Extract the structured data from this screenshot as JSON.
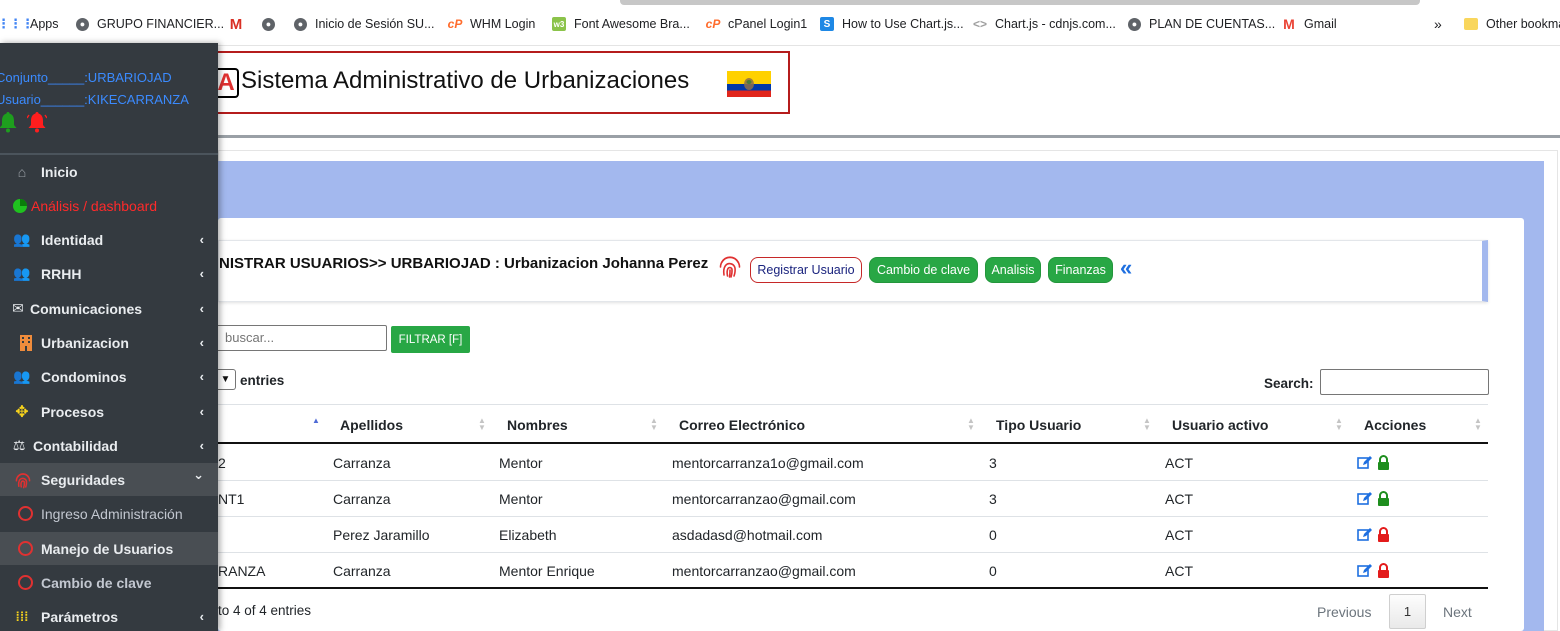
{
  "bookmarks": {
    "items": [
      {
        "label": "Apps",
        "icon": "apps-grid-icon"
      },
      {
        "label": "GRUPO FINANCIER...",
        "icon": "globe-icon"
      },
      {
        "label": "",
        "icon": "gmail-m-icon"
      },
      {
        "label": "",
        "icon": "globe-icon"
      },
      {
        "label": "Inicio de Sesión SU...",
        "icon": "globe-icon"
      },
      {
        "label": "WHM Login",
        "icon": "cpanel-icon"
      },
      {
        "label": "Font Awesome Bra...",
        "icon": "w3-icon"
      },
      {
        "label": "cPanel Login1",
        "icon": "cpanel-icon"
      },
      {
        "label": "How to Use Chart.js...",
        "icon": "s-icon"
      },
      {
        "label": "Chart.js - cdnjs.com...",
        "icon": "code-icon"
      },
      {
        "label": "PLAN DE CUENTAS...",
        "icon": "globe-icon"
      },
      {
        "label": "Gmail",
        "icon": "gmail-icon"
      }
    ],
    "overflow": "»",
    "other_label": "Other bookma"
  },
  "sidebar": {
    "conjunto": "Conjunto_____:URBARIOJAD",
    "usuario": "Usuario______:KIKECARRANZA",
    "items": [
      {
        "label": "Inicio",
        "icon": "home-icon",
        "chevron": ""
      },
      {
        "label": "Análisis / dashboard",
        "icon": "pie-chart-icon",
        "chevron": ""
      },
      {
        "label": "Identidad",
        "icon": "users-icon",
        "chevron": "‹"
      },
      {
        "label": "RRHH",
        "icon": "users-icon",
        "chevron": "‹"
      },
      {
        "label": "Comunicaciones",
        "icon": "envelope-open-icon",
        "chevron": "‹"
      },
      {
        "label": "Urbanizacion",
        "icon": "building-icon",
        "chevron": "‹"
      },
      {
        "label": "Condominos",
        "icon": "users-icon",
        "chevron": "‹"
      },
      {
        "label": "Procesos",
        "icon": "arrows-icon",
        "chevron": "‹"
      },
      {
        "label": "Contabilidad",
        "icon": "balance-scale-icon",
        "chevron": "‹"
      },
      {
        "label": "Seguridades",
        "icon": "fingerprint-icon",
        "chevron": "⌄"
      },
      {
        "label": "Ingreso Administración",
        "icon": "circle-icon",
        "chevron": ""
      },
      {
        "label": "Manejo de Usuarios",
        "icon": "circle-icon",
        "chevron": ""
      },
      {
        "label": "Cambio de clave",
        "icon": "circle-icon",
        "chevron": ""
      },
      {
        "label": "Parámetros",
        "icon": "grid-icon",
        "chevron": "‹"
      }
    ],
    "colors": {
      "accent_red": "#ff2a2a",
      "link_blue": "#3b8bff",
      "bg": "#343a40"
    }
  },
  "header": {
    "logo_letter": "A",
    "title": "Sistema Administrativo de Urbanizaciones"
  },
  "toolbar": {
    "heading": "NISTRAR USUARIOS>> URBARIOJAD : Urbanizacion Johanna Perez",
    "registrar_label": "Registrar Usuario",
    "cambio_label": "Cambio de clave",
    "analisis_label": "Analisis",
    "finanzas_label": "Finanzas",
    "back_icon": "«"
  },
  "filter": {
    "placeholder": "buscar...",
    "button_label": "FILTRAR [F]"
  },
  "table": {
    "entries_label": "entries",
    "search_label": "Search:",
    "columns": [
      "Apellidos",
      "Nombres",
      "Correo Electrónico",
      "Tipo Usuario",
      "Usuario activo",
      "Acciones"
    ],
    "rows": [
      {
        "c0": "2",
        "apellidos": "Carranza",
        "nombres": "Mentor",
        "correo": "mentorcarranza1o@gmail.com",
        "tipo": "3",
        "activo": "ACT",
        "lock": "green"
      },
      {
        "c0": "NT1",
        "apellidos": "Carranza",
        "nombres": "Mentor",
        "correo": "mentorcarranzao@gmail.com",
        "tipo": "3",
        "activo": "ACT",
        "lock": "green"
      },
      {
        "c0": "",
        "apellidos": "Perez Jaramillo",
        "nombres": "Elizabeth",
        "correo": "asdadasd@hotmail.com",
        "tipo": "0",
        "activo": "ACT",
        "lock": "red"
      },
      {
        "c0": "RANZA",
        "apellidos": "Carranza",
        "nombres": "Mentor Enrique",
        "correo": "mentorcarranzao@gmail.com",
        "tipo": "0",
        "activo": "ACT",
        "lock": "red"
      }
    ],
    "info": "to 4 of 4 entries",
    "prev_label": "Previous",
    "page": "1",
    "next_label": "Next"
  }
}
